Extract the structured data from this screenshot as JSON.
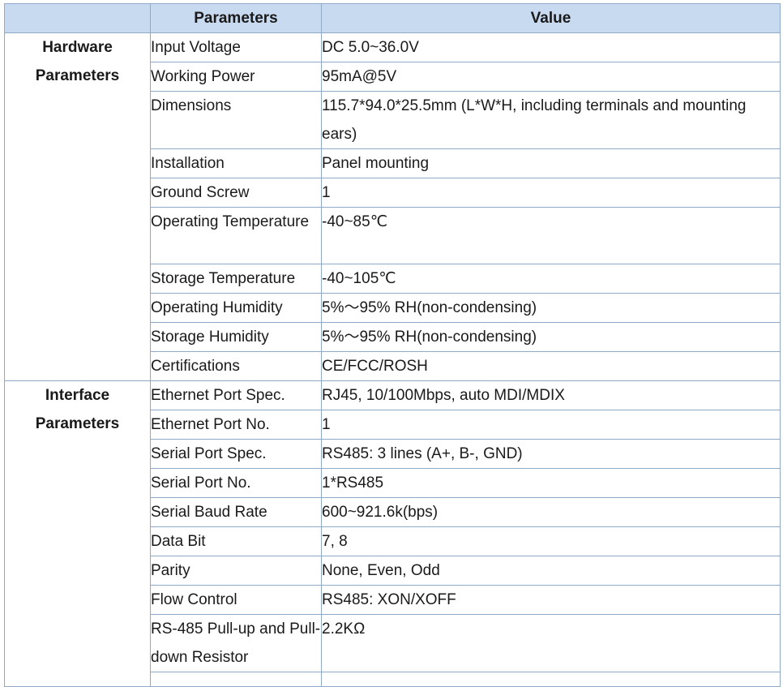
{
  "header": {
    "parameters": "Parameters",
    "value": "Value"
  },
  "groups": {
    "hardware": "Hardware Parameters",
    "interface": "Interface Parameters"
  },
  "rows": [
    {
      "param": "Input Voltage",
      "value": "DC 5.0~36.0V"
    },
    {
      "param": "Working Power",
      "value": "95mA@5V"
    },
    {
      "param": "Dimensions",
      "value": "115.7*94.0*25.5mm (L*W*H, including terminals and mounting ears)"
    },
    {
      "param": "Installation",
      "value": "Panel mounting"
    },
    {
      "param": "Ground Screw",
      "value": "1"
    },
    {
      "param": "Operating Temperature",
      "value": "-40~85℃"
    },
    {
      "param": "Storage Temperature",
      "value": "-40~105℃"
    },
    {
      "param": "Operating Humidity",
      "value": "5%～95% RH(non-condensing)"
    },
    {
      "param": "Storage Humidity",
      "value": "5%～95% RH(non-condensing)"
    },
    {
      "param": "Certifications",
      "value": "CE/FCC/ROSH"
    },
    {
      "param": "Ethernet Port Spec.",
      "value": "RJ45, 10/100Mbps, auto MDI/MDIX"
    },
    {
      "param": "Ethernet Port No.",
      "value": "1"
    },
    {
      "param": "Serial Port Spec.",
      "value": "RS485: 3 lines (A+, B-, GND)"
    },
    {
      "param": "Serial Port No.",
      "value": "1*RS485"
    },
    {
      "param": "Serial Baud Rate",
      "value": "600~921.6k(bps)"
    },
    {
      "param": "Data Bit",
      "value": "7, 8"
    },
    {
      "param": "Parity",
      "value": "None, Even, Odd"
    },
    {
      "param": "Flow Control",
      "value": "RS485: XON/XOFF"
    },
    {
      "param": "RS-485 Pull-up and Pull-down Resistor",
      "value": "2.2KΩ"
    }
  ]
}
